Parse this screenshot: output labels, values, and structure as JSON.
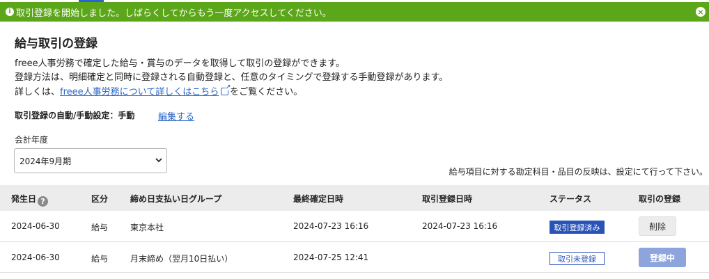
{
  "banner": {
    "info_icon": "i",
    "message": "取引登録を開始しました。しばらくしてからもう一度アクセスしてください。",
    "close_icon": "×"
  },
  "page": {
    "title": "給与取引の登録",
    "description": {
      "line1": "freee人事労務で確定した給与・賞与のデータを取得して取引の登録ができます。",
      "line2": "登録方法は、明細確定と同時に登録される自動登録と、任意のタイミングで登録する手動登録があります。",
      "line3_prefix": "詳しくは、",
      "line3_link": "freee人事労務について詳しくはこちら",
      "line3_suffix": "をご覧ください。"
    },
    "setting": {
      "label": "取引登録の自動/手動設定：手動",
      "edit_link": "編集する"
    },
    "fiscal_year": {
      "label": "会計年度",
      "selected": "2024年9月期"
    },
    "note": "給与項目に対する勘定科目・品目の反映は、設定にて行って下さい。"
  },
  "table": {
    "headers": {
      "date": "発生日",
      "category": "区分",
      "group": "締め日支払い日グループ",
      "confirmed_at": "最終確定日時",
      "registered_at": "取引登録日時",
      "status": "ステータス",
      "action": "取引の登録"
    },
    "help_icon": "?",
    "rows": [
      {
        "date": "2024-06-30",
        "category": "給与",
        "group": "東京本社",
        "confirmed_at": "2024-07-23 16:16",
        "registered_at": "2024-07-23 16:16",
        "status": "取引登録済み",
        "action": "削除"
      },
      {
        "date": "2024-06-30",
        "category": "給与",
        "group": "月末締め（翌月10日払い）",
        "confirmed_at": "2024-07-25 12:41",
        "registered_at": "",
        "status": "取引未登録",
        "action": "登録中"
      }
    ]
  },
  "colors": {
    "banner_bg": "#5ba619",
    "link": "#2a66c7",
    "badge_blue": "#2a53b8",
    "button_disabled": "#8ea4dd"
  }
}
